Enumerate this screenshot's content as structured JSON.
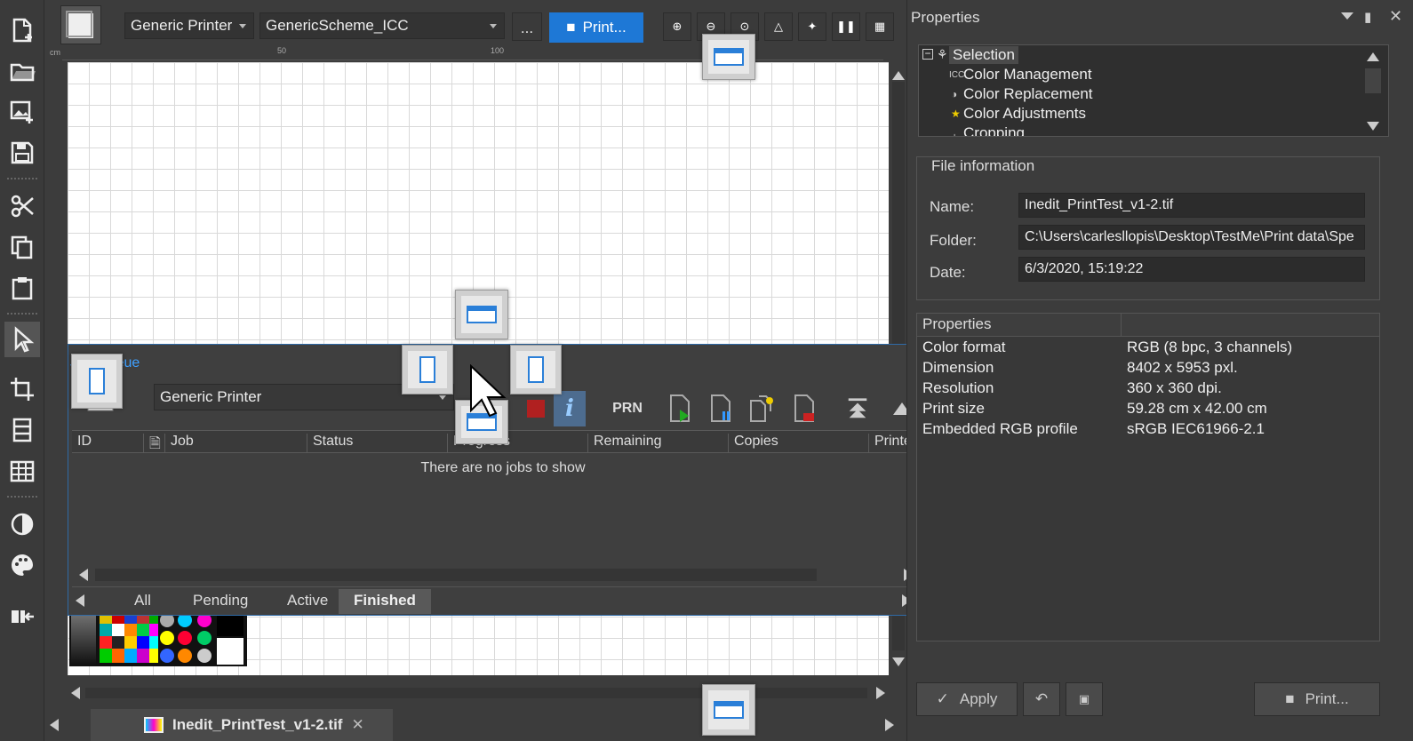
{
  "toolbar": {
    "printer": "Generic Printer",
    "scheme": "GenericScheme_ICC",
    "more_label": "...",
    "print_label": "Print..."
  },
  "ruler": {
    "ticks": [
      "cm",
      "50",
      "100"
    ]
  },
  "document_tab": {
    "name": "Inedit_PrintTest_v1-2.tif"
  },
  "job_queue": {
    "title": "Job Queue",
    "printer": "Generic Printer",
    "prn_label": "PRN",
    "columns": [
      "ID",
      "Job",
      "Status",
      "Progress",
      "Remaining",
      "Copies",
      "Printed"
    ],
    "empty_message": "There are no jobs to show",
    "tabs": [
      "All",
      "Pending",
      "Active",
      "Finished"
    ],
    "active_tab": "Finished"
  },
  "properties_panel": {
    "title": "Properties",
    "tree": {
      "root": "Selection",
      "items": [
        "Color Management",
        "Color Replacement",
        "Color Adjustments",
        "Cropping"
      ]
    },
    "file_info": {
      "title": "File information",
      "name_label": "Name:",
      "name_value": "Inedit_PrintTest_v1-2.tif",
      "folder_label": "Folder:",
      "folder_value": "C:\\Users\\carlesllopis\\Desktop\\TestMe\\Print data\\Spe",
      "date_label": "Date:",
      "date_value": "6/3/2020, 15:19:22"
    },
    "grid": {
      "header": "Properties",
      "rows": [
        {
          "name": "Color format",
          "value": "RGB (8 bpc, 3 channels)"
        },
        {
          "name": "Dimension",
          "value": "8402 x 5953 pxl."
        },
        {
          "name": "Resolution",
          "value": "360 x 360 dpi."
        },
        {
          "name": "Print size",
          "value": "59.28 cm x 42.00 cm"
        },
        {
          "name": "Embedded RGB profile",
          "value": "sRGB IEC61966-2.1"
        }
      ]
    },
    "apply_label": "Apply",
    "print_label": "Print..."
  },
  "colors": {
    "accent": "#1e78d6",
    "panel_bg": "#3c3c3c",
    "title_link": "#3fa0ff"
  }
}
